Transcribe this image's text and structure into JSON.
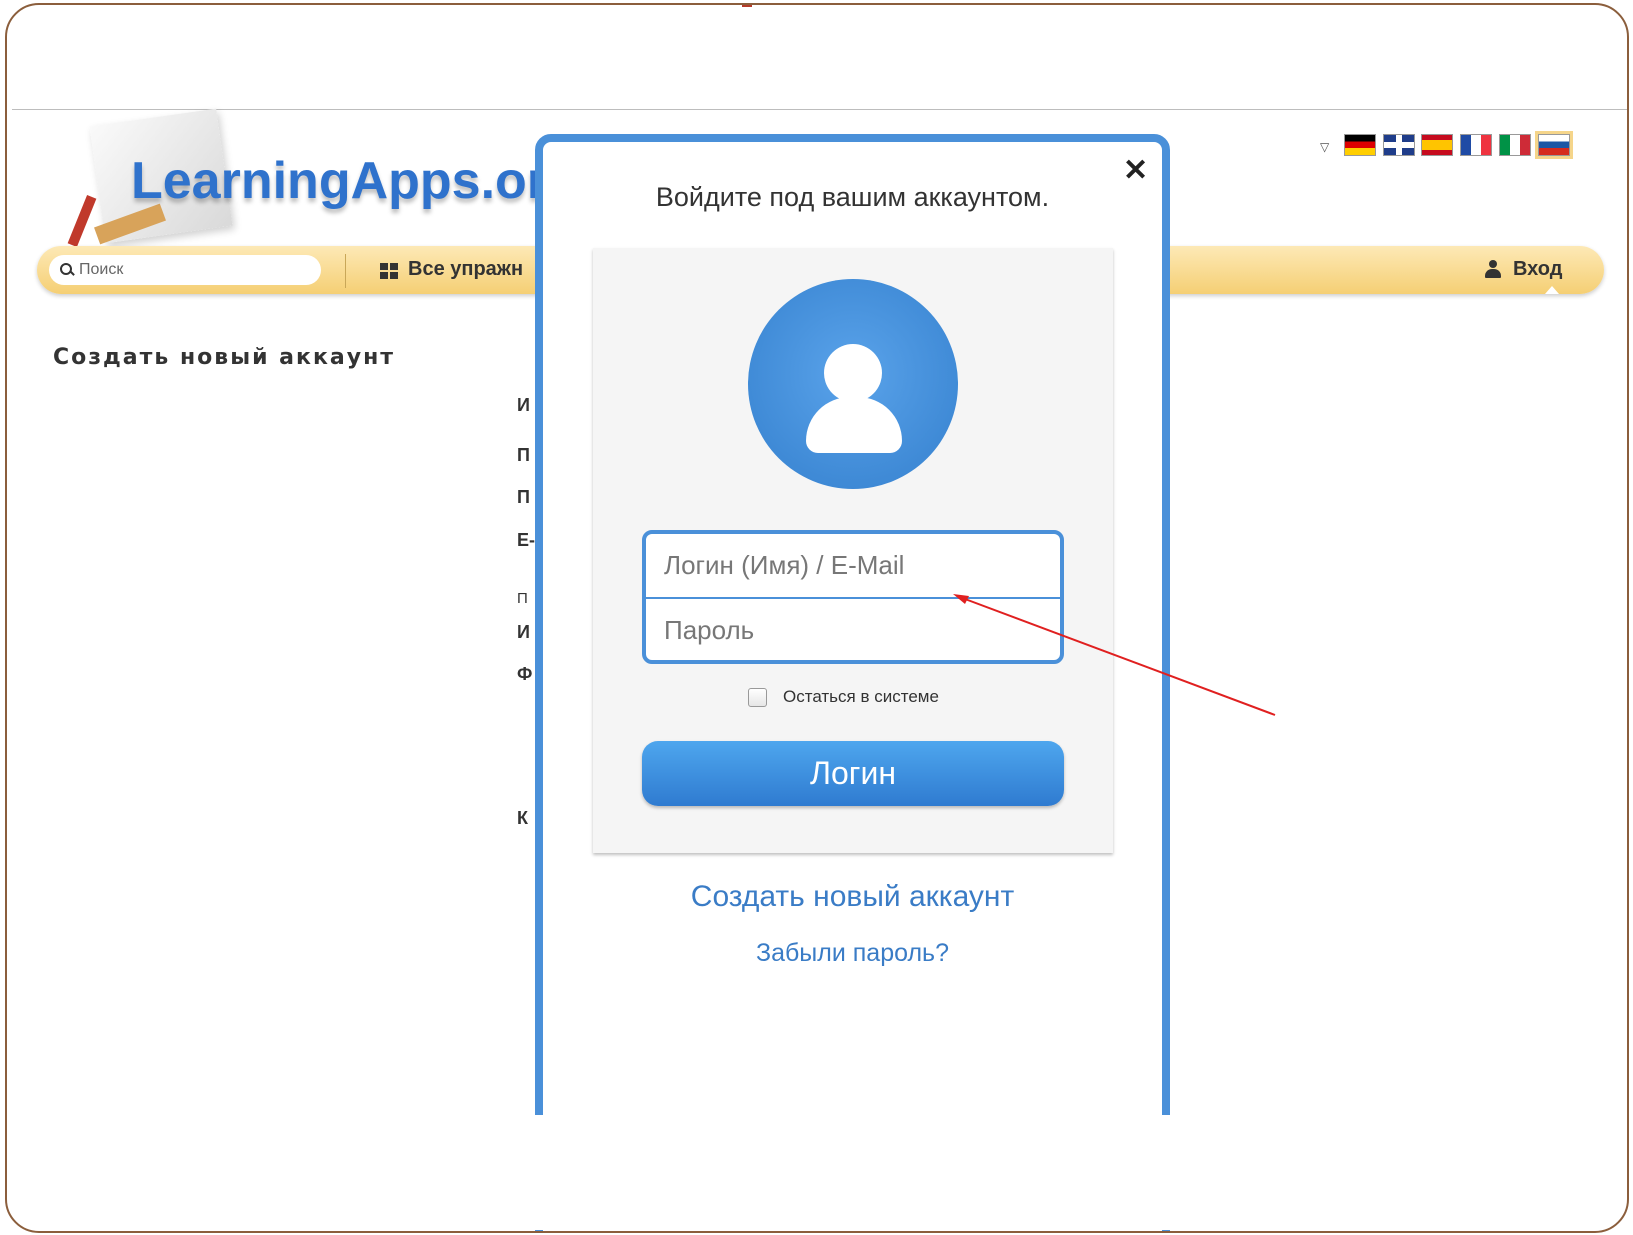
{
  "site": {
    "logo_text": "LearningApps.org"
  },
  "navbar": {
    "search_placeholder": "Поиск",
    "exercises_label": "Все упражн",
    "login_label": "Вход"
  },
  "languages": [
    "de",
    "en",
    "es",
    "fr",
    "it",
    "ru"
  ],
  "page": {
    "heading": "Создать новый аккаунт",
    "cut_labels": [
      "И",
      "П",
      "П",
      "Е-",
      "П",
      "И",
      "Ф",
      "К"
    ]
  },
  "modal": {
    "title": "Войдите под вашим аккаунтом.",
    "close_symbol": "✕",
    "username_placeholder": "Логин (Имя) / E-Mail",
    "password_placeholder": "Пароль",
    "remember_label": "Остаться в системе",
    "login_button": "Логин",
    "create_account_link": "Создать новый аккаунт",
    "forgot_password_link": "Забыли пароль?"
  },
  "colors": {
    "accent_blue": "#4a90d9",
    "link_blue": "#3a7cc6",
    "navbar_yellow": "#f5cf74",
    "annotation_red": "#e02020",
    "frame_brown": "#8b5e3c"
  }
}
